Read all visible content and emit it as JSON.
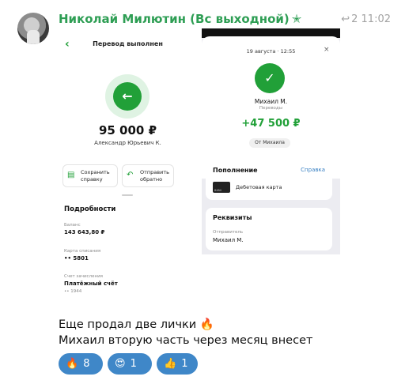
{
  "message": {
    "sender": "Николай Милютин (Вс выходной)",
    "sender_emoji": "✭",
    "reply_icon": "↩",
    "forward_count": "2",
    "time": "11:02",
    "text_lines": [
      "Еще продал две лички 🔥",
      "Михаил вторую часть через месяц внесет"
    ],
    "reactions": [
      {
        "emoji": "🔥",
        "count": "8"
      },
      {
        "emoji": "😍",
        "count": "1"
      },
      {
        "emoji": "👍",
        "count": "1"
      }
    ]
  },
  "screenshot_left": {
    "back_icon": "‹",
    "title": "Перевод выполнен",
    "status_icon": "←",
    "amount": "95 000 ₽",
    "recipient": "Александр Юрьевич К.",
    "actions": [
      {
        "icon": "▤",
        "label": "Сохранить справку"
      },
      {
        "icon": "↶",
        "label": "Отправить обратно"
      }
    ],
    "details": {
      "heading": "Подробности",
      "balance_label": "Баланс",
      "balance_value": "143 643,80 ₽",
      "card_label": "Карта списания",
      "card_value": "•• 5801",
      "account_label": "Счет зачисления",
      "account_value": "Платёжный счёт",
      "account_sub": "•• 1944"
    }
  },
  "screenshot_right": {
    "date": "19 августа · 12:55",
    "close_icon": "×",
    "check_icon": "✓",
    "name": "Михаил М.",
    "subtitle": "Переводы",
    "amount": "+47 500 ₽",
    "from_pill": "От Михаила",
    "topup": {
      "heading": "Пополнение",
      "link": "Справка",
      "card_digits": "6484",
      "card_type": "Дебетовая карта"
    },
    "requisites": {
      "heading": "Реквизиты",
      "sender_label": "Отправитель",
      "sender_value": "Михаил М."
    }
  }
}
